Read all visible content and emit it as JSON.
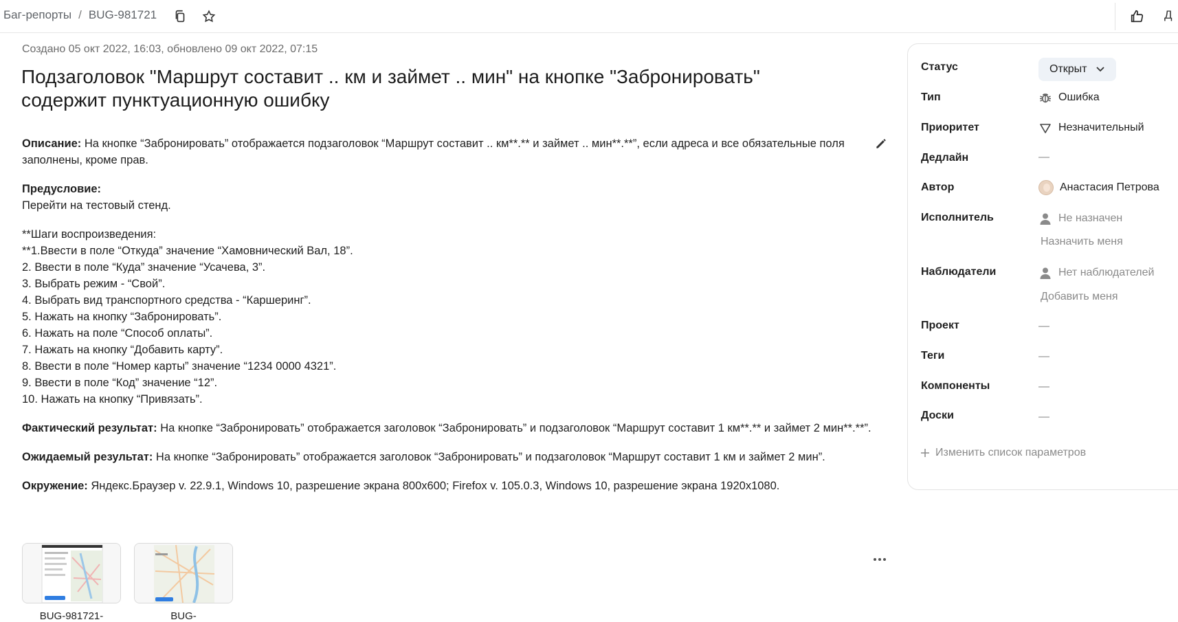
{
  "topbar": {
    "breadcrumb_root": "Баг-репорты",
    "breadcrumb_sep": "/",
    "issue_key": "BUG-981721",
    "right_button_label": "Д"
  },
  "issue": {
    "meta": "Создано 05 окт 2022, 16:03, обновлено 09 окт 2022, 07:15",
    "title": "Подзаголовок \"Маршрут составит .. км и займет .. мин\" на кнопке \"Забронировать\" содержит пунктуационную ошибку",
    "description_label": "Описание:",
    "description_text": " На кнопке “Забронировать” отображается подзаголовок “Маршрут составит .. км**.** и займет .. мин**.**”, если адреса и все обязательные поля заполнены, кроме прав.",
    "precondition_label": "Предусловие:",
    "precondition_text": "Перейти на тестовый стенд.",
    "steps_header": "**Шаги воспроизведения:",
    "steps": [
      "**1.Ввести в поле “Откуда” значение “Хамовнический Вал, 18”.",
      "2. Ввести в поле “Куда” значение “Усачева, 3”.",
      "3. Выбрать режим - “Свой”.",
      "4. Выбрать вид транспортного средства - “Каршеринг”.",
      "5. Нажать на кнопку “Забронировать”.",
      "6. Нажать на поле “Способ оплаты”.",
      "7. Нажать на кнопку “Добавить карту”.",
      "8. Ввести в поле “Номер карты” значение “1234 0000 4321”.",
      "9. Ввести в поле “Код” значение “12”.",
      "10. Нажать на кнопку “Привязать”."
    ],
    "actual_label": "Фактический результат:",
    "actual_text": " На кнопке “Забронировать” отображается заголовок “Забронировать” и подзаголовок “Маршрут составит 1 км**.** и займет 2 мин**.**”.",
    "expected_label": "Ожидаемый результат:",
    "expected_text": " На кнопке “Забронировать” отображается заголовок “Забронировать” и подзаголовок “Маршрут составит 1 км и займет 2 мин”.",
    "env_label": "Окружение:",
    "env_text": " Яндекс.Браузер v. 22.9.1, Windows 10, разрешение экрана 800x600; Firefox v. 105.0.3, Windows 10, разрешение экрана 1920x1080.",
    "attachments": [
      {
        "name": "BUG-981721-"
      },
      {
        "name": "BUG-"
      }
    ]
  },
  "panel": {
    "status_label": "Статус",
    "status_value": "Открыт",
    "type_label": "Тип",
    "type_value": "Ошибка",
    "priority_label": "Приоритет",
    "priority_value": "Незначительный",
    "deadline_label": "Дедлайн",
    "deadline_value": "—",
    "author_label": "Автор",
    "author_value": "Анастасия Петрова",
    "assignee_label": "Исполнитель",
    "assignee_value": "Не назначен",
    "assign_me": "Назначить меня",
    "watchers_label": "Наблюдатели",
    "watchers_value": "Нет наблюдателей",
    "add_me": "Добавить меня",
    "project_label": "Проект",
    "project_value": "—",
    "tags_label": "Теги",
    "tags_value": "—",
    "components_label": "Компоненты",
    "components_value": "—",
    "boards_label": "Доски",
    "boards_value": "—",
    "change_params": "Изменить список параметров"
  }
}
